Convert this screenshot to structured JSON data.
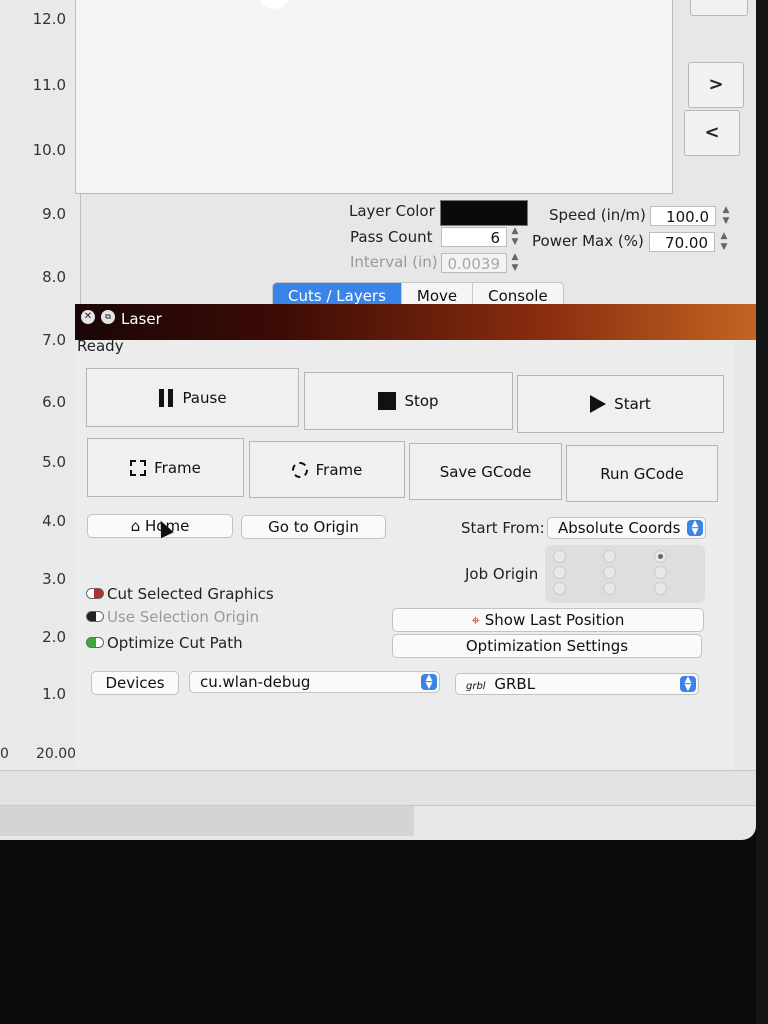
{
  "ruler": {
    "ticks": [
      "12.0",
      "11.0",
      "10.0",
      "9.0",
      "8.0",
      "7.0",
      "6.0",
      "5.0",
      "4.0",
      "3.0",
      "2.0",
      "1.0"
    ],
    "corner_left": "0",
    "corner_label": "20.00"
  },
  "canvas_nav": {
    "next": ">",
    "prev": "<"
  },
  "layer": {
    "color_label": "Layer Color",
    "color_value": "#0a0a0a",
    "pass_label": "Pass Count",
    "pass_value": "6",
    "interval_label": "Interval (in)",
    "interval_value": "0.0039",
    "speed_label": "Speed (in/m)",
    "speed_value": "100.0",
    "power_label": "Power Max (%)",
    "power_value": "70.00"
  },
  "tabs": [
    "Cuts / Layers",
    "Move",
    "Console"
  ],
  "laser_window": {
    "title": "Laser",
    "status": "Ready"
  },
  "buttons": {
    "pause": "Pause",
    "stop": "Stop",
    "start": "Start",
    "frame1": "Frame",
    "frame2": "Frame",
    "save_gcode": "Save GCode",
    "run_gcode": "Run GCode",
    "home": "Home",
    "go_origin": "Go to Origin",
    "show_last": "Show Last Position",
    "opt_settings": "Optimization Settings",
    "devices": "Devices"
  },
  "start_from": {
    "label": "Start From:",
    "value": "Absolute Coords"
  },
  "job_origin": {
    "label": "Job Origin"
  },
  "options": {
    "cut_selected": "Cut Selected Graphics",
    "use_selection": "Use Selection Origin",
    "optimize": "Optimize Cut Path"
  },
  "device": {
    "port": "cu.wlan-debug",
    "controller": "GRBL",
    "controller_logo": "grbl"
  },
  "colors": {
    "accent": "#3a84e8",
    "cut_selected_toggle": "#b03030",
    "optimize_toggle": "#3aaa3a"
  }
}
